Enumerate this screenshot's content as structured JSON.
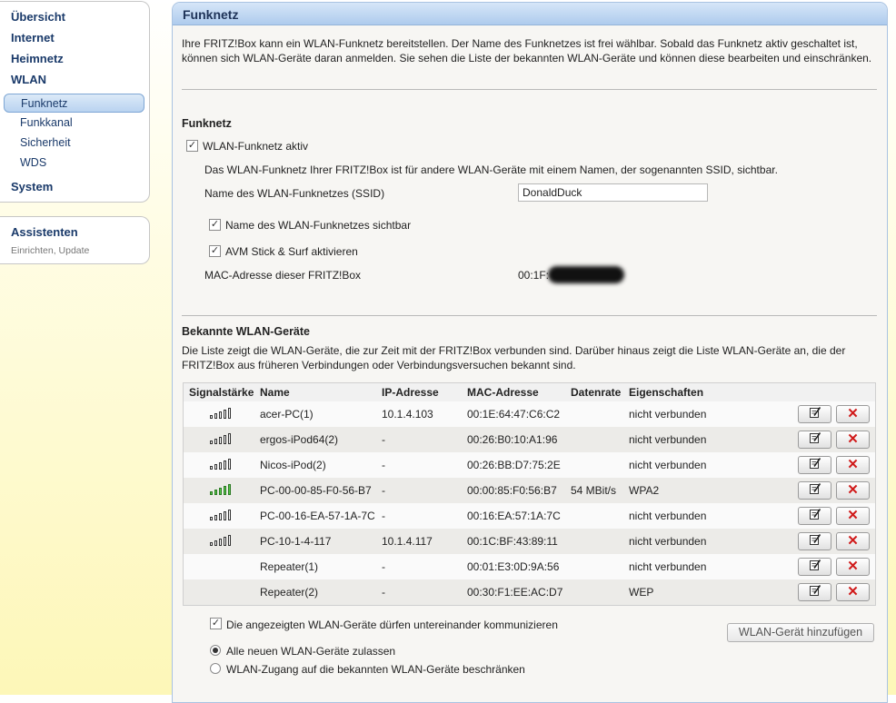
{
  "sidebar": {
    "items": [
      {
        "label": "Übersicht"
      },
      {
        "label": "Internet"
      },
      {
        "label": "Heimnetz"
      },
      {
        "label": "WLAN"
      },
      {
        "label": "System"
      }
    ],
    "wlan_sub": [
      {
        "label": "Funknetz",
        "active": true
      },
      {
        "label": "Funkkanal"
      },
      {
        "label": "Sicherheit"
      },
      {
        "label": "WDS"
      }
    ],
    "assistants": {
      "title": "Assistenten",
      "subtitle": "Einrichten, Update"
    }
  },
  "panel": {
    "title": "Funknetz",
    "intro": "Ihre FRITZ!Box kann ein WLAN-Funknetz bereitstellen. Der Name des Funknetzes ist frei wählbar. Sobald das Funknetz aktiv geschaltet ist, können sich WLAN-Geräte daran anmelden. Sie sehen die Liste der bekannten WLAN-Geräte und können diese bearbeiten und einschränken."
  },
  "funknetz": {
    "heading": "Funknetz",
    "wlan_active": {
      "label": "WLAN-Funknetz aktiv",
      "checked": true
    },
    "ssid_info": "Das WLAN-Funknetz Ihrer FRITZ!Box ist für andere WLAN-Geräte mit einem Namen, der sogenannten SSID, sichtbar.",
    "ssid_label": "Name des WLAN-Funknetzes (SSID)",
    "ssid_value": "DonaldDuck",
    "ssid_visible": {
      "label": "Name des WLAN-Funknetzes sichtbar",
      "checked": true
    },
    "stick_surf": {
      "label": "AVM Stick & Surf aktivieren",
      "checked": true
    },
    "mac_label": "MAC-Adresse dieser FRITZ!Box",
    "mac_value": "00:1F:"
  },
  "devices": {
    "heading": "Bekannte WLAN-Geräte",
    "description": "Die Liste zeigt die WLAN-Geräte, die zur Zeit mit der FRITZ!Box verbunden sind. Darüber hinaus zeigt die Liste WLAN-Geräte an, die der FRITZ!Box aus früheren Verbindungen oder Verbindungsversuchen bekannt sind.",
    "columns": [
      "Signalstärke",
      "Name",
      "IP-Adresse",
      "MAC-Adresse",
      "Datenrate",
      "Eigenschaften"
    ],
    "rows": [
      {
        "signal": "gray",
        "name": "acer-PC(1)",
        "ip": "10.1.4.103",
        "mac": "00:1E:64:47:C6:C2",
        "rate": "",
        "props": "nicht verbunden"
      },
      {
        "signal": "gray",
        "name": "ergos-iPod64(2)",
        "ip": "-",
        "mac": "00:26:B0:10:A1:96",
        "rate": "",
        "props": "nicht verbunden"
      },
      {
        "signal": "gray",
        "name": "Nicos-iPod(2)",
        "ip": "-",
        "mac": "00:26:BB:D7:75:2E",
        "rate": "",
        "props": "nicht verbunden"
      },
      {
        "signal": "green",
        "name": "PC-00-00-85-F0-56-B7",
        "ip": "-",
        "mac": "00:00:85:F0:56:B7",
        "rate": "54 MBit/s",
        "props": "WPA2"
      },
      {
        "signal": "gray",
        "name": "PC-00-16-EA-57-1A-7C",
        "ip": "-",
        "mac": "00:16:EA:57:1A:7C",
        "rate": "",
        "props": "nicht verbunden"
      },
      {
        "signal": "gray",
        "name": "PC-10-1-4-117",
        "ip": "10.1.4.117",
        "mac": "00:1C:BF:43:89:11",
        "rate": "",
        "props": "nicht verbunden"
      },
      {
        "signal": "none",
        "name": "Repeater(1)",
        "ip": "-",
        "mac": "00:01:E3:0D:9A:56",
        "rate": "",
        "props": "nicht verbunden"
      },
      {
        "signal": "none",
        "name": "Repeater(2)",
        "ip": "-",
        "mac": "00:30:F1:EE:AC:D7",
        "rate": "",
        "props": "WEP"
      }
    ],
    "edit_icon": "edit-icon",
    "delete_icon": "delete-x-icon",
    "communicate": {
      "label": "Die angezeigten WLAN-Geräte dürfen untereinander kommunizieren",
      "checked": true
    },
    "add_button": "WLAN-Gerät hinzufügen",
    "allow_all": {
      "label": "Alle neuen WLAN-Geräte zulassen",
      "selected": true
    },
    "restrict": {
      "label": "WLAN-Zugang auf die bekannten WLAN-Geräte beschränken",
      "selected": false
    }
  },
  "colors": {
    "accent": "#1a3a6a",
    "delete": "#d01a1a",
    "signal_active": "#57c84a"
  }
}
